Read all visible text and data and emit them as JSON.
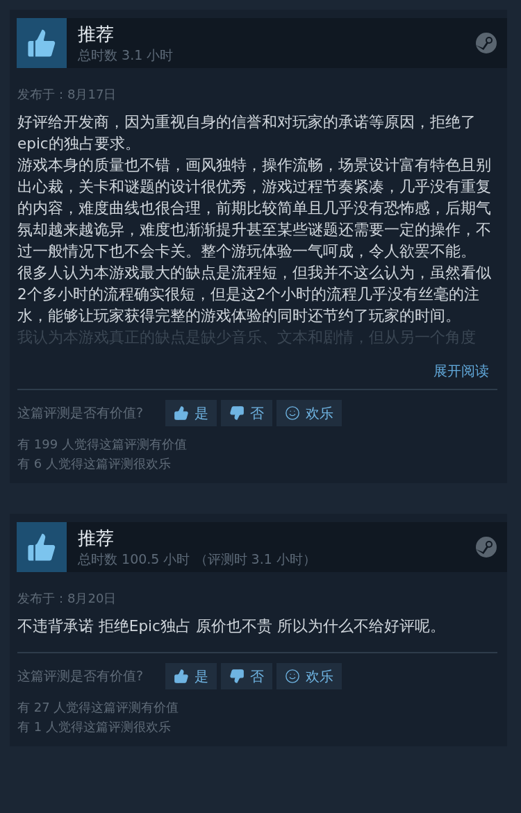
{
  "reviews": [
    {
      "verdict": "推荐",
      "playtime": "总时数 3.1 小时",
      "posted": "发布于：8月17日",
      "paragraphs": [
        {
          "text": "好评给开发商，因为重视自身的信誉和对玩家的承诺等原因，拒绝了epic的独占要求。",
          "faded": false
        },
        {
          "text": "游戏本身的质量也不错，画风独特，操作流畅，场景设计富有特色且别出心裁，关卡和谜题的设计很优秀，游戏过程节奏紧凑，几乎没有重复的内容，难度曲线也很合理，前期比较简单且几乎没有恐怖感，后期气氛却越来越诡异，难度也渐渐提升甚至某些谜题还需要一定的操作，不过一般情况下也不会卡关。整个游玩体验一气呵成，令人欲罢不能。",
          "faded": false
        },
        {
          "text": "很多人认为本游戏最大的缺点是流程短，但我并不这么认为，虽然看似2个多小时的流程确实很短，但是这2个小时的流程几乎没有丝毫的注水，能够让玩家获得完整的游戏体验的同时还节约了玩家的时间。",
          "faded": false
        },
        {
          "text": "我认为本游戏真正的缺点是缺少音乐、文本和剧情，但从另一个角度",
          "faded": true
        }
      ],
      "expand_link": "展开阅读",
      "helpful_prompt": "这篇评测是否有价值?",
      "vote_buttons": [
        {
          "kind": "yes",
          "label": "是"
        },
        {
          "kind": "no",
          "label": "否"
        },
        {
          "kind": "funny",
          "label": "欢乐"
        }
      ],
      "counts": [
        "有 199 人觉得这篇评测有价值",
        "有 6 人觉得这篇评测很欢乐"
      ]
    },
    {
      "verdict": "推荐",
      "playtime": "总时数 100.5 小时 （评测时 3.1 小时）",
      "posted": "发布于：8月20日",
      "paragraphs": [
        {
          "text": "不违背承诺 拒绝Epic独占 原价也不贵 所以为什么不给好评呢。",
          "faded": false
        }
      ],
      "helpful_prompt": "这篇评测是否有价值?",
      "vote_buttons": [
        {
          "kind": "yes",
          "label": "是"
        },
        {
          "kind": "no",
          "label": "否"
        },
        {
          "kind": "funny",
          "label": "欢乐"
        }
      ],
      "counts": [
        "有 27 人觉得这篇评测有价值",
        "有 1 人觉得这篇评测很欢乐"
      ]
    }
  ]
}
